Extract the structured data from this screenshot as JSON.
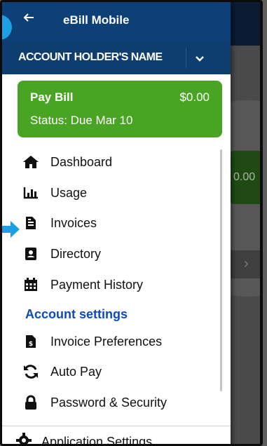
{
  "header": {
    "back_icon": "arrow-left-icon",
    "title": "eBill Mobile",
    "account_name": "ACCOUNT HOLDER'S NAME",
    "account_dropdown_icon": "chevron-down-icon"
  },
  "pay_card": {
    "label": "Pay Bill",
    "amount": "$0.00",
    "status": "Status: Due Mar 10"
  },
  "menu": {
    "items": [
      {
        "label": "Dashboard",
        "icon": "home-icon"
      },
      {
        "label": "Usage",
        "icon": "bar-chart-icon"
      },
      {
        "label": "Invoices",
        "icon": "invoice-icon"
      },
      {
        "label": "Directory",
        "icon": "contact-card-icon"
      },
      {
        "label": "Payment History",
        "icon": "calendar-icon"
      }
    ],
    "section_heading": "Account settings",
    "settings_items": [
      {
        "label": "Invoice Preferences",
        "icon": "invoice-dollar-icon"
      },
      {
        "label": "Auto Pay",
        "icon": "sync-icon"
      },
      {
        "label": "Password & Security",
        "icon": "lock-icon"
      }
    ]
  },
  "footer": {
    "label": "Application Settings",
    "icon": "gear-icon"
  },
  "background": {
    "amount_fragment": "0.00"
  },
  "colors": {
    "header_bg": "#0b3e73",
    "pay_card_bg": "#4aa423",
    "section_heading": "#0e4bb3",
    "highlight_marker": "#1aa0e3"
  }
}
